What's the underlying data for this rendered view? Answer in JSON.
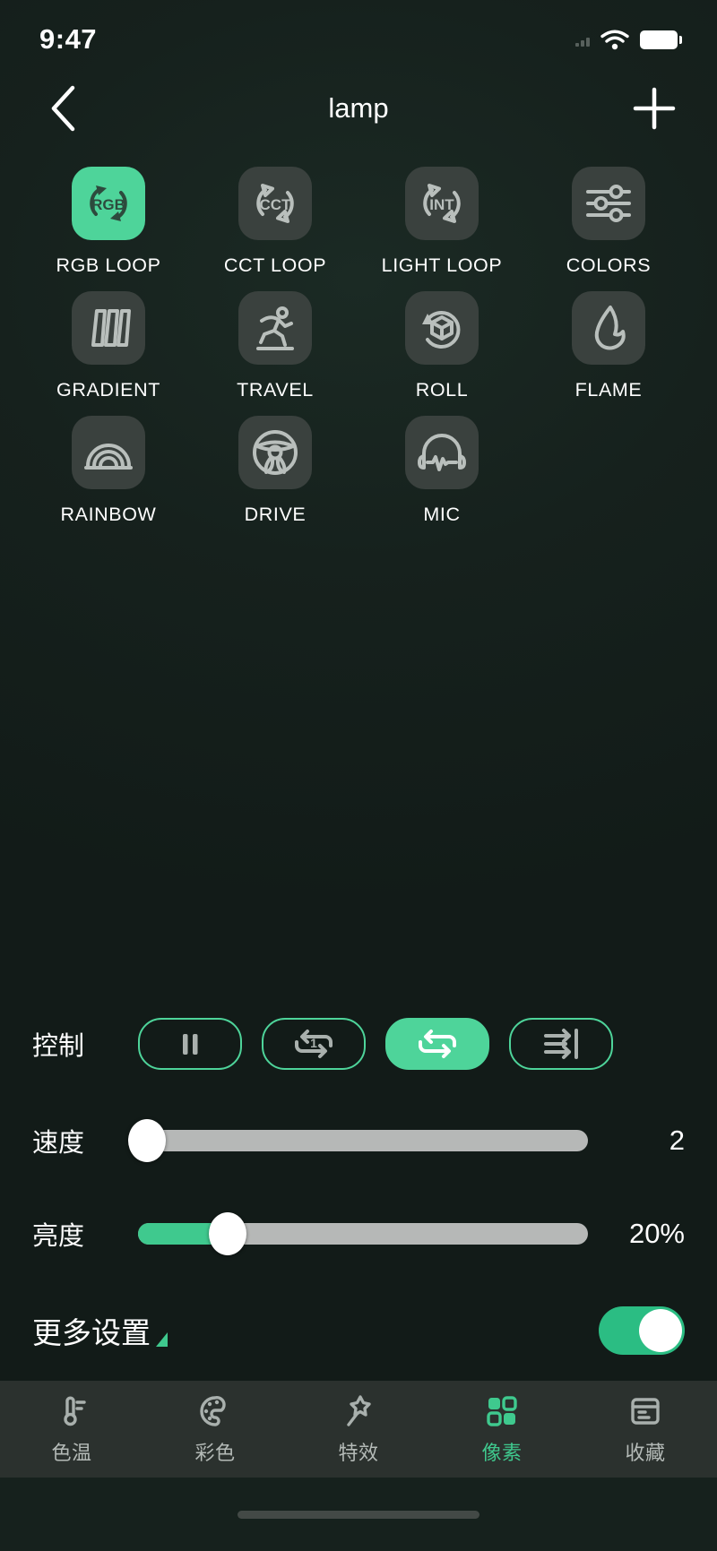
{
  "status_bar": {
    "time": "9:47",
    "wifi_icon": "wifi-icon",
    "battery_icon": "battery-full-icon"
  },
  "header": {
    "back_icon": "chevron-left-icon",
    "title": "lamp",
    "add_icon": "plus-icon"
  },
  "colors": {
    "accent": "#4ed49a",
    "accent_fill": "#3fc98e",
    "background": "#16211d",
    "tile": "#3a413e",
    "tabbar": "#2b312e",
    "track": "#b6b8b7",
    "icon_gray": "#b9bfbc"
  },
  "effects": [
    {
      "label": "RGB LOOP",
      "icon": "rgb-loop-icon",
      "selected": true
    },
    {
      "label": "CCT LOOP",
      "icon": "cct-loop-icon",
      "selected": false
    },
    {
      "label": "LIGHT LOOP",
      "icon": "int-loop-icon",
      "selected": false
    },
    {
      "label": "COLORS",
      "icon": "sliders-icon",
      "selected": false
    },
    {
      "label": "GRADIENT",
      "icon": "gradient-bars-icon",
      "selected": false
    },
    {
      "label": "TRAVEL",
      "icon": "running-person-icon",
      "selected": false
    },
    {
      "label": "ROLL",
      "icon": "rotating-cube-icon",
      "selected": false
    },
    {
      "label": "FLAME",
      "icon": "flame-icon",
      "selected": false
    },
    {
      "label": "RAINBOW",
      "icon": "rainbow-arcs-icon",
      "selected": false
    },
    {
      "label": "DRIVE",
      "icon": "steering-wheel-icon",
      "selected": false
    },
    {
      "label": "MIC",
      "icon": "headphone-waveform-icon",
      "selected": false
    }
  ],
  "control": {
    "label": "控制",
    "buttons": [
      {
        "icon": "pause-icon",
        "active": false
      },
      {
        "icon": "repeat-one-icon",
        "active": false
      },
      {
        "icon": "repeat-all-icon",
        "active": true
      },
      {
        "icon": "play-to-end-icon",
        "active": false
      }
    ]
  },
  "speed": {
    "label": "速度",
    "value": "2",
    "percent": 2
  },
  "brightness": {
    "label": "亮度",
    "value": "20%",
    "percent": 20
  },
  "more_settings": {
    "label": "更多设置",
    "caret_icon": "triangle-expand-icon",
    "toggle_on": true
  },
  "tabs": [
    {
      "label": "色温",
      "icon": "thermometer-icon",
      "active": false
    },
    {
      "label": "彩色",
      "icon": "palette-icon",
      "active": false
    },
    {
      "label": "特效",
      "icon": "magic-wand-icon",
      "active": false
    },
    {
      "label": "像素",
      "icon": "pixel-grid-icon",
      "active": true
    },
    {
      "label": "收藏",
      "icon": "archive-box-icon",
      "active": false
    }
  ]
}
